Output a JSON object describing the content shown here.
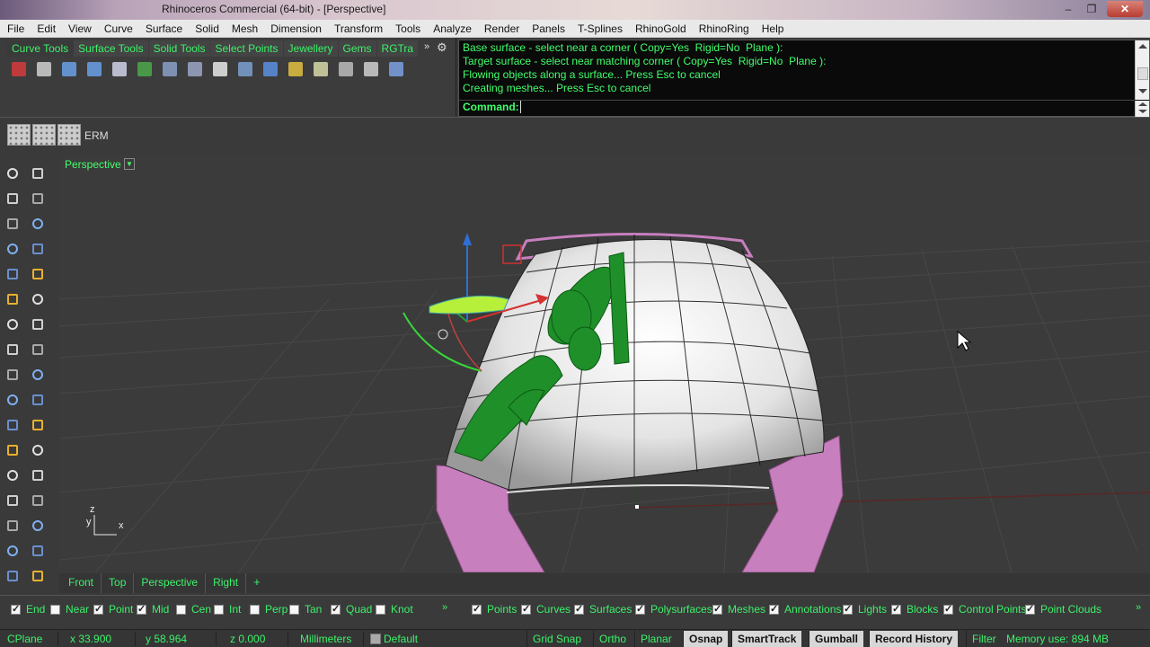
{
  "window": {
    "title": "Rhinoceros Commercial (64-bit) - [Perspective]",
    "minimize": "–",
    "restore": "❐",
    "close": "✕"
  },
  "menubar": [
    "File",
    "Edit",
    "View",
    "Curve",
    "Surface",
    "Solid",
    "Mesh",
    "Dimension",
    "Transform",
    "Tools",
    "Analyze",
    "Render",
    "Panels",
    "T-Splines",
    "RhinoGold",
    "RhinoRing",
    "Help"
  ],
  "toolbar_tabs": [
    "Curve Tools",
    "Surface Tools",
    "Solid Tools",
    "Select Points",
    "Jewellery",
    "Gems",
    "RGTra"
  ],
  "toolbar_more": "»",
  "toolbar_gear": "⚙",
  "toolbar_icons": [
    {
      "name": "point-edit-icon",
      "color": "#d63b3b"
    },
    {
      "name": "control-points-icon",
      "color": "#cfcfcf"
    },
    {
      "name": "sweep1-icon",
      "color": "#6aa0e6"
    },
    {
      "name": "sweep2-icon",
      "color": "#6aa0e6"
    },
    {
      "name": "blend-surface-icon",
      "color": "#d0d0e8"
    },
    {
      "name": "mirror-icon",
      "color": "#4aa84a"
    },
    {
      "name": "scale-icon",
      "color": "#8aa0c8"
    },
    {
      "name": "array-icon",
      "color": "#9aa6c6"
    },
    {
      "name": "grid-array-icon",
      "color": "#e8e8e8"
    },
    {
      "name": "flow-along-surface-icon",
      "color": "#7aa0d0"
    },
    {
      "name": "box-edit-icon",
      "color": "#5a8fe0"
    },
    {
      "name": "gem-icon",
      "color": "#e0c040"
    },
    {
      "name": "map-icon",
      "color": "#d8d8a8"
    },
    {
      "name": "wire-icon",
      "color": "#bbbbbb"
    },
    {
      "name": "move-icon",
      "color": "#cfcfcf"
    },
    {
      "name": "pen-icon",
      "color": "#7aa0e0"
    }
  ],
  "command_history": [
    "Base surface - select near a corner ( Copy=Yes  Rigid=No  Plane ):",
    "Target surface - select near matching corner ( Copy=Yes  Rigid=No  Plane ):",
    "Flowing objects along a surface... Press Esc to cancel",
    "Creating meshes... Press Esc to cancel"
  ],
  "command_prompt": "Command:",
  "display_toolbar": {
    "label": "ERM"
  },
  "viewport": {
    "name": "Perspective",
    "dropdown": "▼",
    "axis_z": "z",
    "axis_y": "y",
    "axis_x": "x"
  },
  "view_tabs": [
    "Front",
    "Top",
    "Perspective",
    "Right"
  ],
  "view_tab_add": "+",
  "osnaps": [
    {
      "label": "End",
      "checked": true
    },
    {
      "label": "Near",
      "checked": false
    },
    {
      "label": "Point",
      "checked": true
    },
    {
      "label": "Mid",
      "checked": true
    },
    {
      "label": "Cen",
      "checked": false
    },
    {
      "label": "Int",
      "checked": false
    },
    {
      "label": "Perp",
      "checked": false
    },
    {
      "label": "Tan",
      "checked": false
    },
    {
      "label": "Quad",
      "checked": true
    },
    {
      "label": "Knot",
      "checked": false
    }
  ],
  "filters": [
    {
      "label": "Points",
      "checked": true
    },
    {
      "label": "Curves",
      "checked": true
    },
    {
      "label": "Surfaces",
      "checked": true
    },
    {
      "label": "Polysurfaces",
      "checked": true
    },
    {
      "label": "Meshes",
      "checked": true
    },
    {
      "label": "Annotations",
      "checked": true
    },
    {
      "label": "Lights",
      "checked": true
    },
    {
      "label": "Blocks",
      "checked": true
    },
    {
      "label": "Control Points",
      "checked": true
    },
    {
      "label": "Point Clouds",
      "checked": true
    }
  ],
  "osnap_more": "»",
  "filter_more": "»",
  "status": {
    "cplane": "CPlane",
    "x": "x 33.900",
    "y": "y 58.964",
    "z": "z 0.000",
    "units": "Millimeters",
    "layer": "Default",
    "grid_snap": "Grid Snap",
    "ortho": "Ortho",
    "planar": "Planar",
    "osnap": "Osnap",
    "smarttrack": "SmartTrack",
    "gumball": "Gumball",
    "record_history": "Record History",
    "filter": "Filter",
    "memory": "Memory use: 894 MB"
  },
  "colors": {
    "accent_green": "#3cf26a",
    "command_green": "#41ff6b",
    "ring_pink": "#c77fbe",
    "ornament_green": "#1f8f2a",
    "viewport_bg": "#3b3b3b"
  }
}
